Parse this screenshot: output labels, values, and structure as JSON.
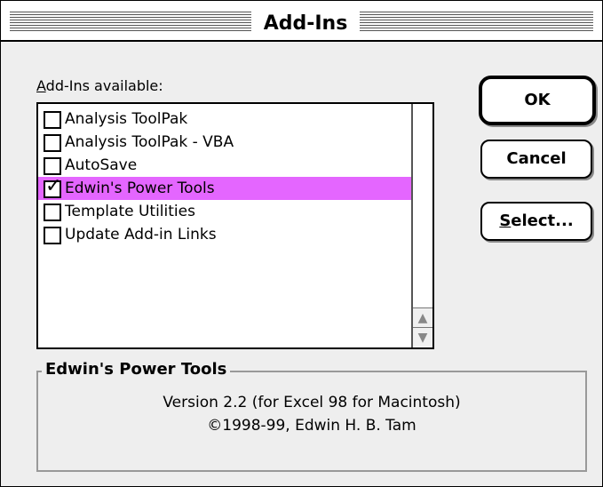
{
  "dialog": {
    "title": "Add-Ins",
    "list_label_prefix": "A",
    "list_label_rest": "dd-Ins available:"
  },
  "addins": [
    {
      "label": "Analysis ToolPak",
      "checked": false,
      "selected": false
    },
    {
      "label": "Analysis ToolPak - VBA",
      "checked": false,
      "selected": false
    },
    {
      "label": "AutoSave",
      "checked": false,
      "selected": false
    },
    {
      "label": "Edwin's Power Tools",
      "checked": true,
      "selected": true
    },
    {
      "label": "Template Utilities",
      "checked": false,
      "selected": false
    },
    {
      "label": "Update Add-in Links",
      "checked": false,
      "selected": false
    }
  ],
  "buttons": {
    "ok": "OK",
    "cancel": "Cancel",
    "select_prefix": "S",
    "select_rest": "elect..."
  },
  "description": {
    "title": "Edwin's Power Tools",
    "line1": "Version 2.2 (for Excel 98 for Macintosh)",
    "line2": "©1998-99, Edwin H. B. Tam"
  },
  "colors": {
    "selection": "#e466ff",
    "background": "#eeeeee"
  },
  "icons": {
    "scroll_up": "up-arrow-icon",
    "scroll_down": "down-arrow-icon",
    "check": "checkmark-icon"
  }
}
